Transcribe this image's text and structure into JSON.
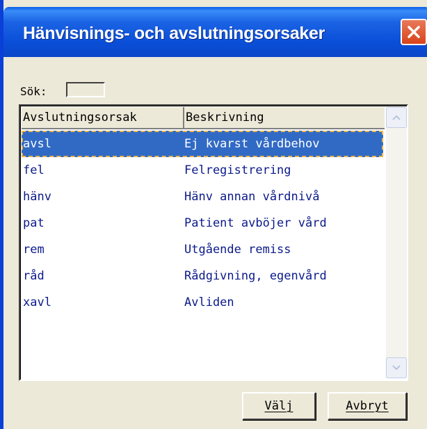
{
  "window": {
    "title": "Hänvisnings- och avslutningsorsaker"
  },
  "search": {
    "label": "Sök:",
    "value": ""
  },
  "list": {
    "columns": [
      "Avslutningsorsak",
      "Beskrivning"
    ],
    "rows": [
      {
        "code": "avsl",
        "description": "Ej kvarst vårdbehov",
        "selected": true
      },
      {
        "code": "fel",
        "description": "Felregistrering",
        "selected": false
      },
      {
        "code": "hänv",
        "description": "Hänv annan vårdnivå",
        "selected": false
      },
      {
        "code": "pat",
        "description": "Patient avböjer vård",
        "selected": false
      },
      {
        "code": "rem",
        "description": "Utgående remiss",
        "selected": false
      },
      {
        "code": "råd",
        "description": "Rådgivning, egenvård",
        "selected": false
      },
      {
        "code": "xavl",
        "description": "Avliden",
        "selected": false
      }
    ]
  },
  "buttons": {
    "ok": "Välj",
    "cancel": "Avbryt"
  },
  "colors": {
    "titlebar": "#0a4fd8",
    "selection": "#316ac5",
    "row_text": "#0b1a8a",
    "close": "#d8441a"
  },
  "icons": {
    "close": "close-icon",
    "scroll_up": "chevron-up-icon",
    "scroll_down": "chevron-down-icon"
  }
}
